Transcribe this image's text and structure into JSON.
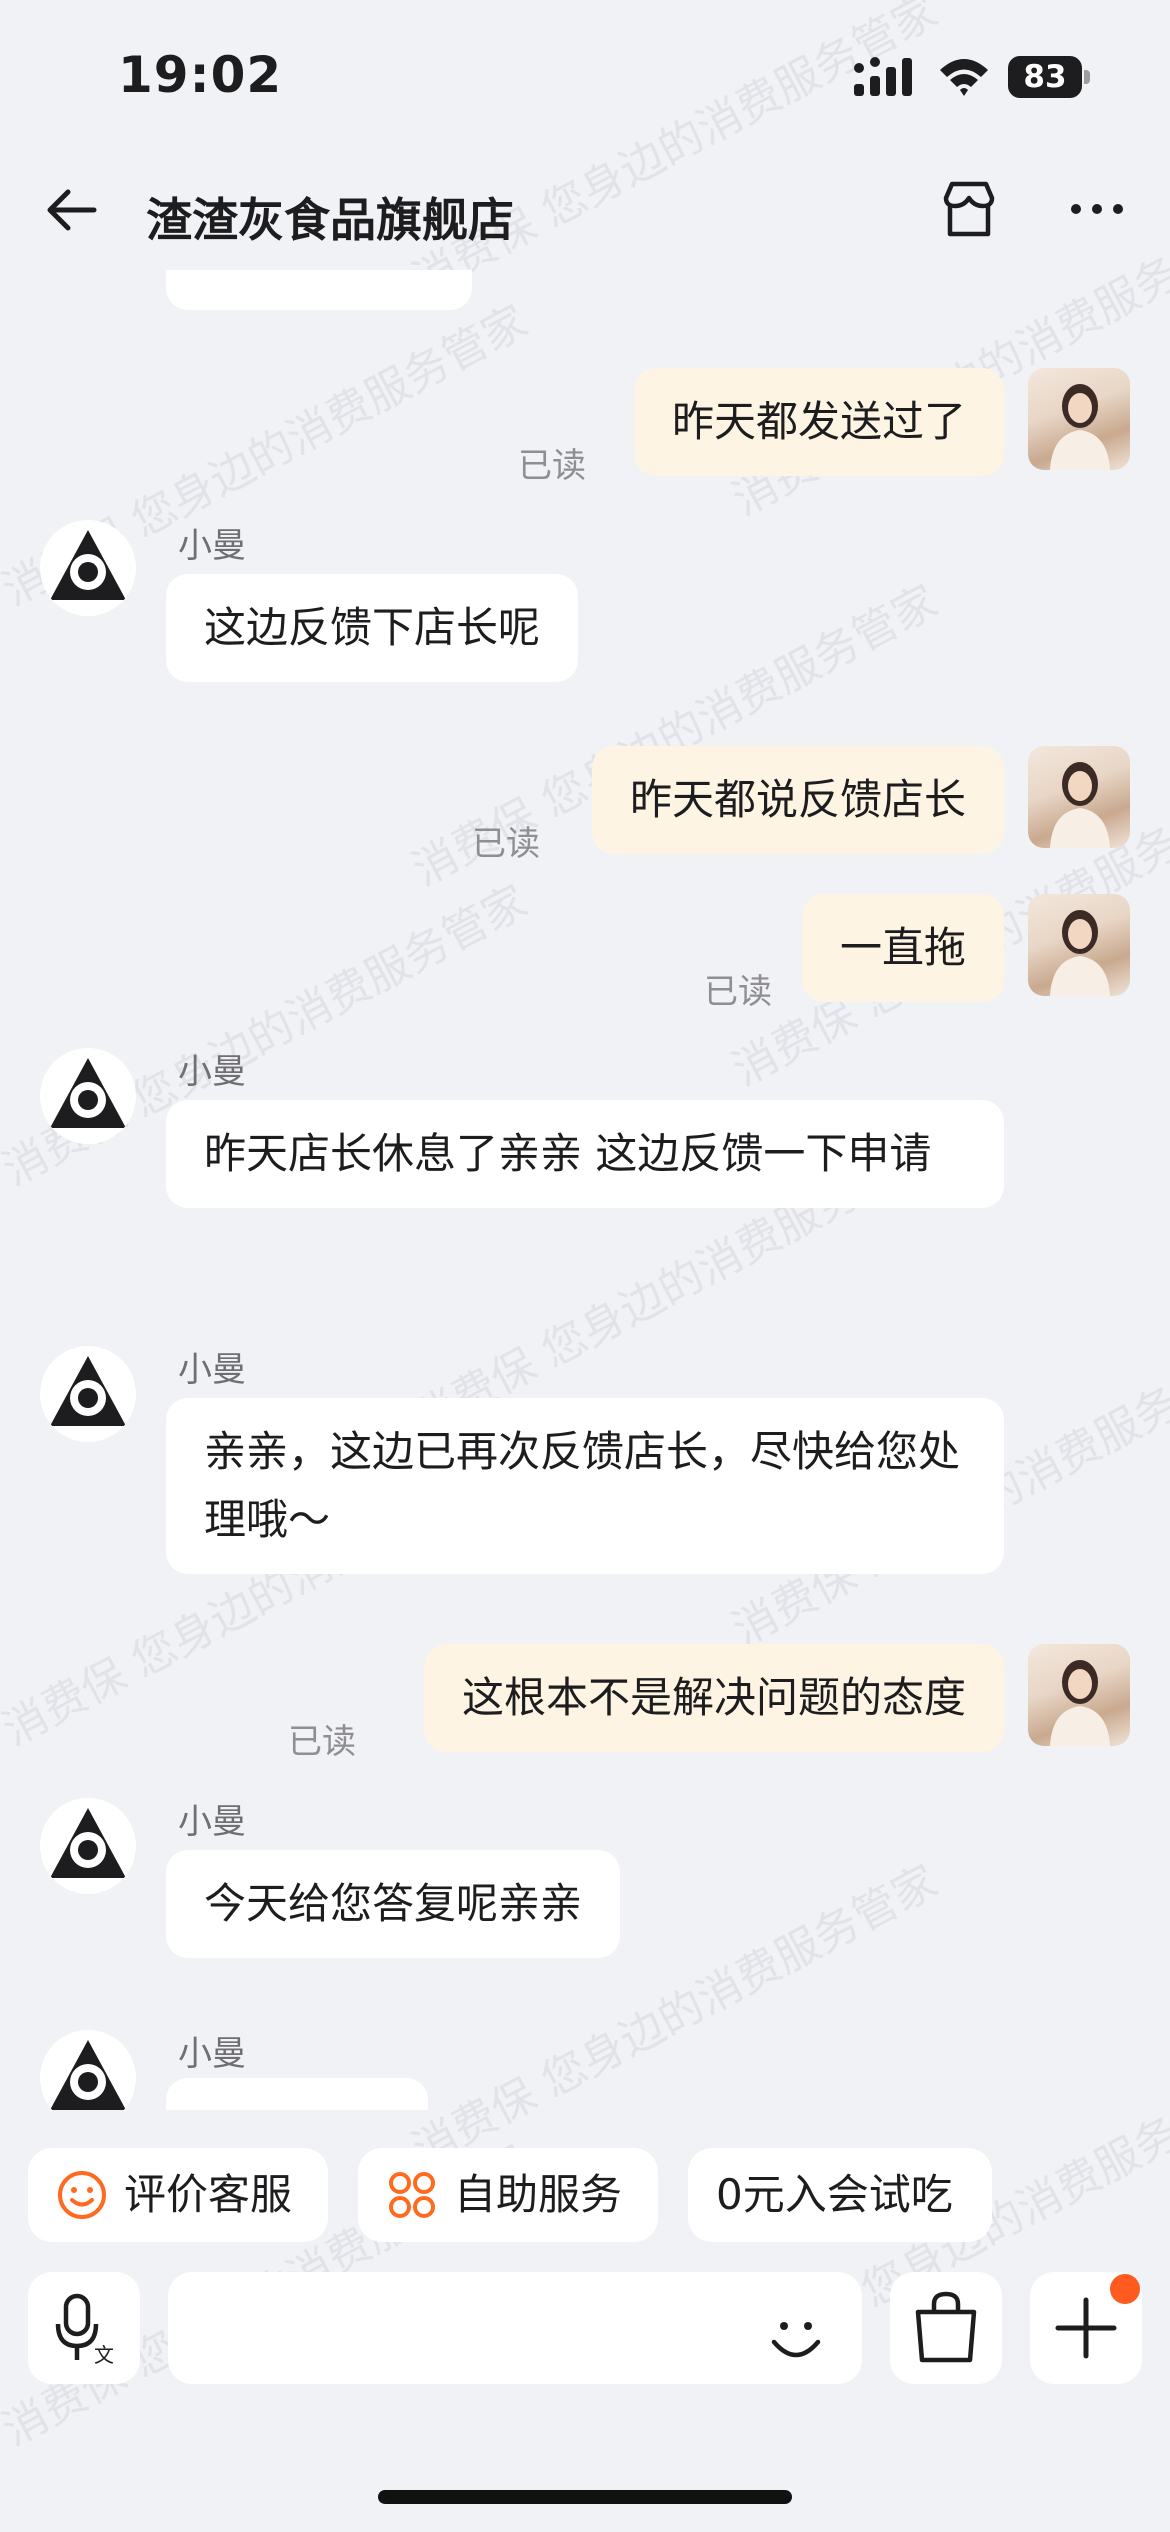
{
  "status_bar": {
    "time": "19:02",
    "battery": "83"
  },
  "header": {
    "title": "渣渣灰食品旗舰店"
  },
  "messages": [
    {
      "from": "me",
      "text": "昨天都发送过了",
      "read": "已读"
    },
    {
      "from": "agent",
      "sender": "小曼",
      "text": "这边反馈下店长呢"
    },
    {
      "from": "me",
      "text": "昨天都说反馈店长",
      "read": "已读"
    },
    {
      "from": "me",
      "text": "一直拖",
      "read": "已读"
    },
    {
      "from": "agent",
      "sender": "小曼",
      "text": "昨天店长休息了亲亲 这边反馈一下申请"
    },
    {
      "from": "agent",
      "sender": "小曼",
      "text": "亲亲，这边已再次反馈店长，尽快给您处理哦～"
    },
    {
      "from": "me",
      "text": "这根本不是解决问题的态度",
      "read": "已读"
    },
    {
      "from": "agent",
      "sender": "小曼",
      "text": "今天给您答复呢亲亲"
    },
    {
      "from": "agent",
      "sender": "小曼",
      "text": ""
    }
  ],
  "quick_actions": [
    {
      "label": "评价客服",
      "icon": "smile-icon"
    },
    {
      "label": "自助服务",
      "icon": "grid-icon"
    },
    {
      "label": "0元入会试吃",
      "icon": ""
    }
  ],
  "input": {
    "placeholder": ""
  },
  "watermark": "消费保 您身边的消费服务管家",
  "colors": {
    "accent": "#ff6a1f",
    "my_bubble": "#fdf4e3",
    "background": "#f1f2f6"
  }
}
